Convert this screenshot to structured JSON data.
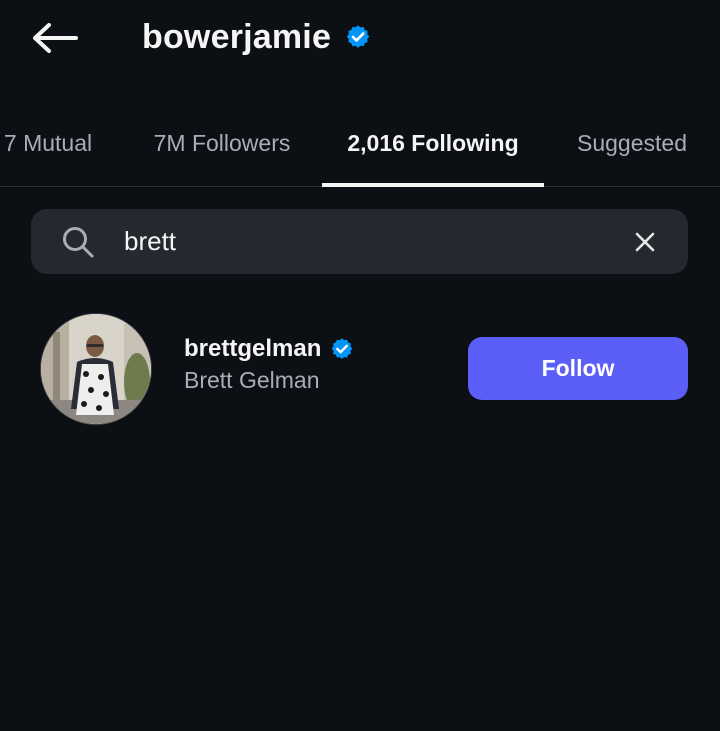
{
  "header": {
    "back_icon": "arrow-left-icon",
    "username": "bowerjamie",
    "verified_icon": "verified-badge-icon",
    "verified_color": "#0095f6"
  },
  "tabs": [
    {
      "label": "7 Mutual",
      "active": false
    },
    {
      "label": "7M Followers",
      "active": false
    },
    {
      "label": "2,016 Following",
      "active": true
    },
    {
      "label": "Suggested",
      "active": false
    }
  ],
  "search": {
    "icon": "search-icon",
    "value": "brett",
    "clear_icon": "close-icon"
  },
  "results": [
    {
      "handle": "brettgelman",
      "name": "Brett Gelman",
      "verified": true,
      "avatar_icon": "profile-photo",
      "button_label": "Follow",
      "button_color": "#5b5ef7"
    }
  ]
}
